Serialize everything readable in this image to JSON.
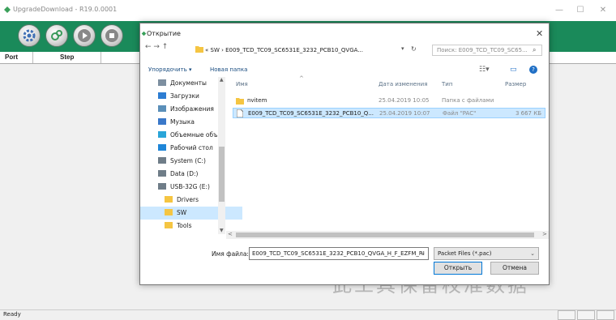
{
  "app": {
    "title": "UpgradeDownload - R19.0.0001",
    "status": "Ready"
  },
  "window_controls": {
    "minimize": "—",
    "maximize": "☐",
    "close": "✕"
  },
  "grid": {
    "port_header": "Port",
    "step_header": "Step"
  },
  "watermark": "此工具保留校准数据",
  "dialog": {
    "title": "Открытие",
    "close": "✕",
    "nav": "←  →  ↑",
    "address": "« SW  ›  E009_TCD_TC09_SC6531E_3232_PCB10_QVGA...",
    "search_placeholder": "Поиск: E009_TCD_TC09_SC65...",
    "organize": "Упорядочить ▾",
    "new_folder": "Новая папка",
    "tree": [
      {
        "label": "Документы",
        "color": "#7d8fa0"
      },
      {
        "label": "Загрузки",
        "color": "#2d7dd2"
      },
      {
        "label": "Изображения",
        "color": "#5b8fb9"
      },
      {
        "label": "Музыка",
        "color": "#3a78c9"
      },
      {
        "label": "Объемные объ",
        "color": "#2aa5d8"
      },
      {
        "label": "Рабочий стол",
        "color": "#1f86d8"
      },
      {
        "label": "System (C:)",
        "color": "#6f7d88"
      },
      {
        "label": "Data (D:)",
        "color": "#6f7d88"
      },
      {
        "label": "USB-32G (E:)",
        "color": "#6f7d88"
      },
      {
        "label": "Drivers",
        "color": "#f5c542"
      },
      {
        "label": "SW",
        "color": "#f5c542"
      },
      {
        "label": "Tools",
        "color": "#f5c542"
      }
    ],
    "columns": {
      "name": "Имя",
      "date": "Дата изменения",
      "type": "Тип",
      "size": "Размер"
    },
    "files": [
      {
        "name": "nvitem",
        "date": "25.04.2019 10:05",
        "type": "Папка с файлами",
        "size": ""
      },
      {
        "name": "E009_TCD_TC09_SC6531E_3232_PCB10_Q...",
        "date": "25.04.2019 10:07",
        "type": "Файл \"PAC\"",
        "size": "3 667 КБ"
      }
    ],
    "filename_label": "Имя файла:",
    "filename_value": "E009_TCD_TC09_SC6531E_3232_PCB10_QVGA_H_F_EZFM_RI",
    "filter": "Packet Files (*.pac)",
    "open": "Открыть",
    "cancel": "Отмена"
  }
}
